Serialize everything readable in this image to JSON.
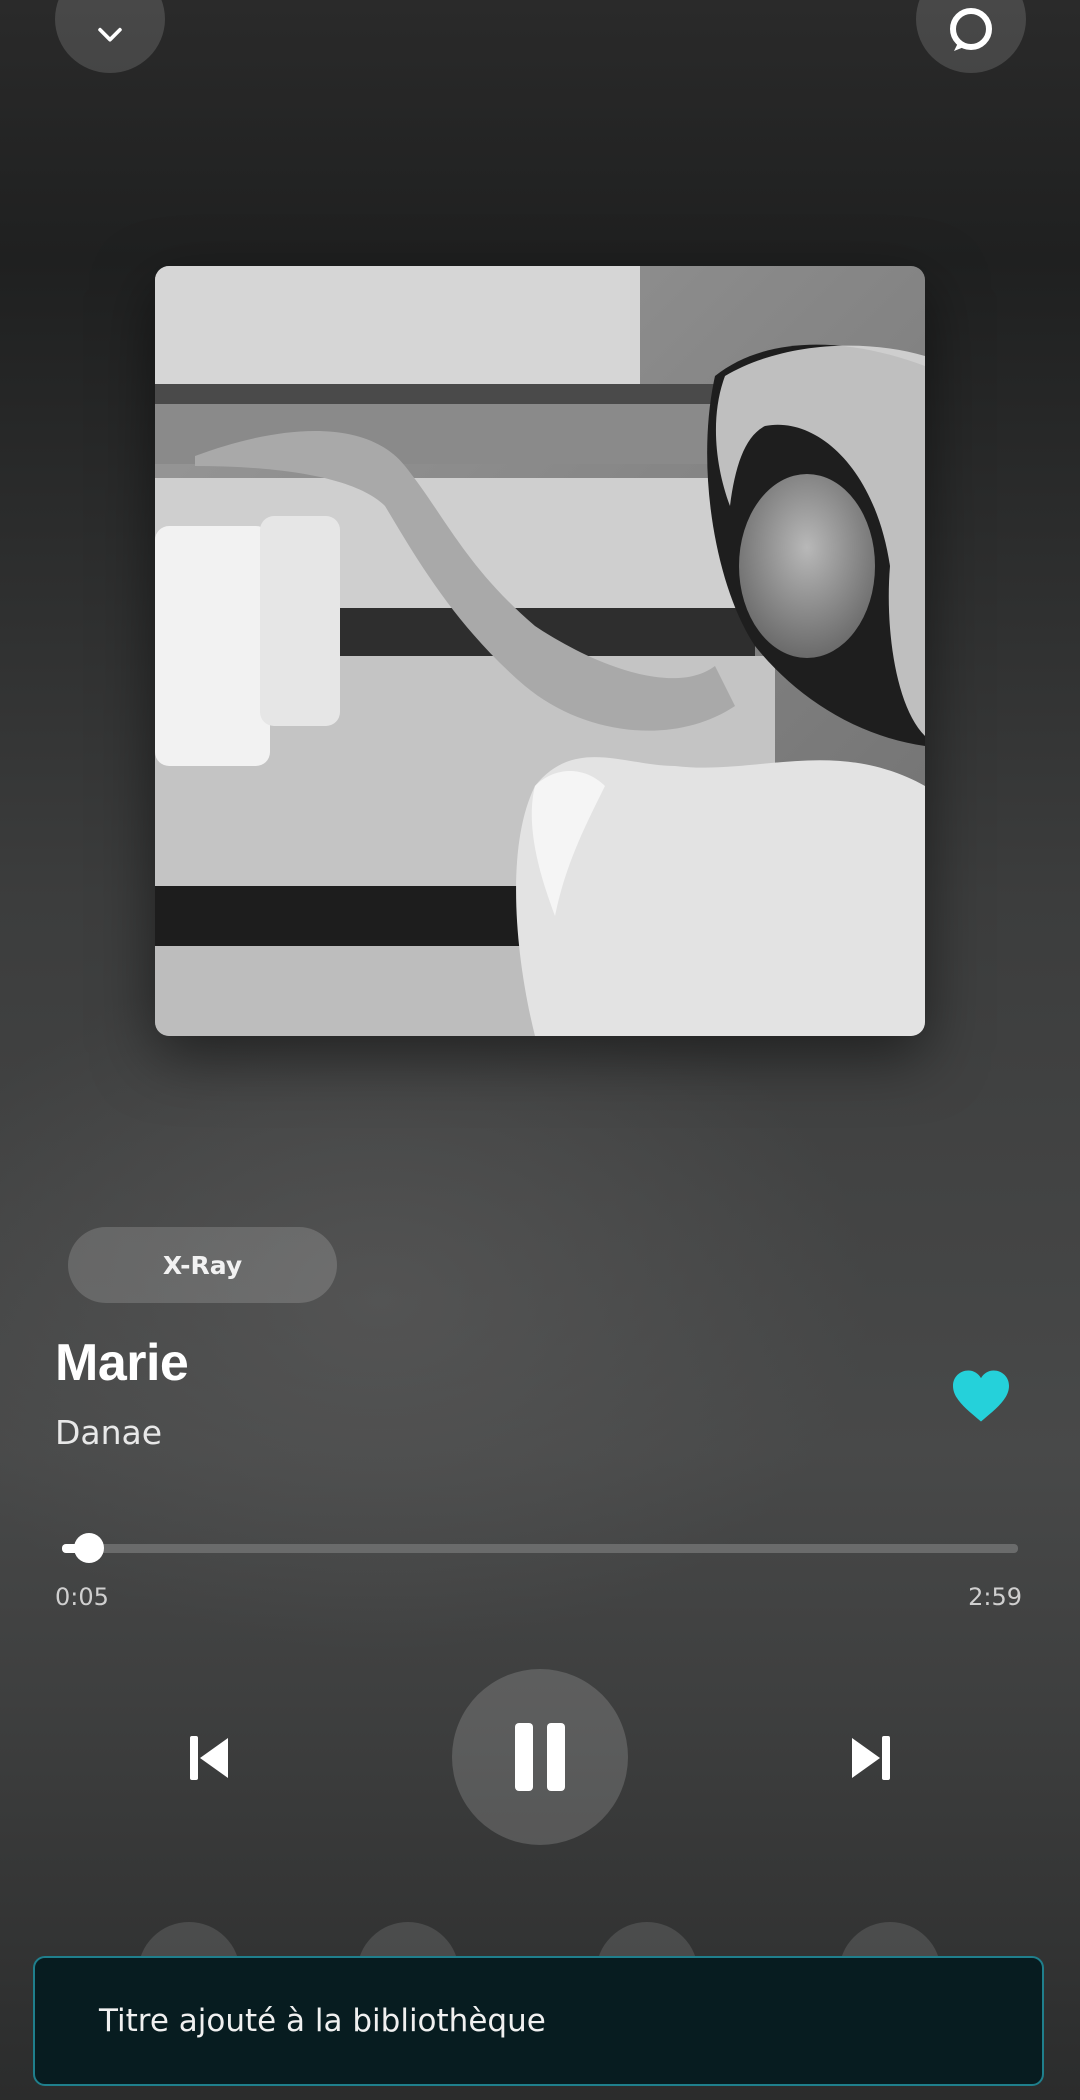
{
  "top_bar": {
    "collapse_icon": "chevron-down-icon",
    "cast_icon": "alexa-ring-icon"
  },
  "album_art": {
    "description_icon": "album-cover-image"
  },
  "xray": {
    "label": "X-Ray"
  },
  "track": {
    "title": "Marie",
    "artist": "Danae",
    "liked": true,
    "like_color": "#25d1da"
  },
  "progress": {
    "elapsed": "0:05",
    "duration": "2:59",
    "fraction": 0.028
  },
  "controls": {
    "previous_icon": "skip-previous-icon",
    "play_pause_icon": "pause-icon",
    "next_icon": "skip-next-icon"
  },
  "toast": {
    "message": "Titre ajouté à la bibliothèque",
    "border_color": "#1f7f8c"
  }
}
